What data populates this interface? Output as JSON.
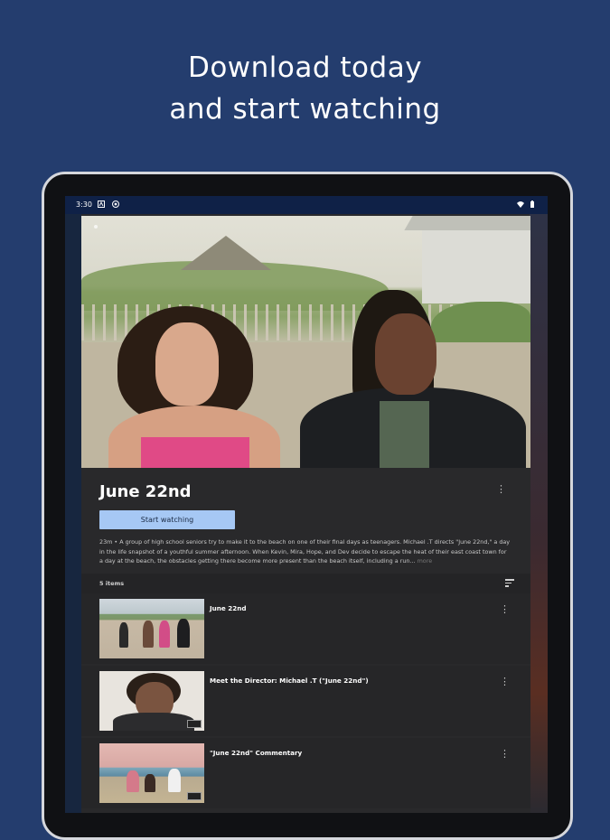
{
  "promo": {
    "line1": "Download today",
    "line2": "and start watching"
  },
  "status_bar": {
    "time": "3:30"
  },
  "colors": {
    "background": "#243d6e",
    "start_button": "#a6c8f4",
    "panel": "#29292b"
  },
  "show": {
    "title": "June 22nd",
    "start_label": "Start watching",
    "description": "23m • A group of high school seniors try to make it to the beach on one of their final days as teenagers. Michael .T directs \"June 22nd,\" a day in the life snapshot of a youthful summer afternoon. When Kevin, Mira, Hope, and Dev decide to escape the heat of their east coast town for a day at the beach, the obstacles getting there become more present than the beach itself, including a run...",
    "more_label": "more"
  },
  "items_header": {
    "count_label": "5 items"
  },
  "episodes": [
    {
      "title": "June 22nd",
      "thumb_icon": "beach-group-thumbnail"
    },
    {
      "title": "Meet the Director: Michael .T (\"June 22nd\")",
      "thumb_icon": "director-portrait-thumbnail"
    },
    {
      "title": "\"June 22nd\" Commentary",
      "thumb_icon": "beach-sunset-thumbnail"
    }
  ]
}
